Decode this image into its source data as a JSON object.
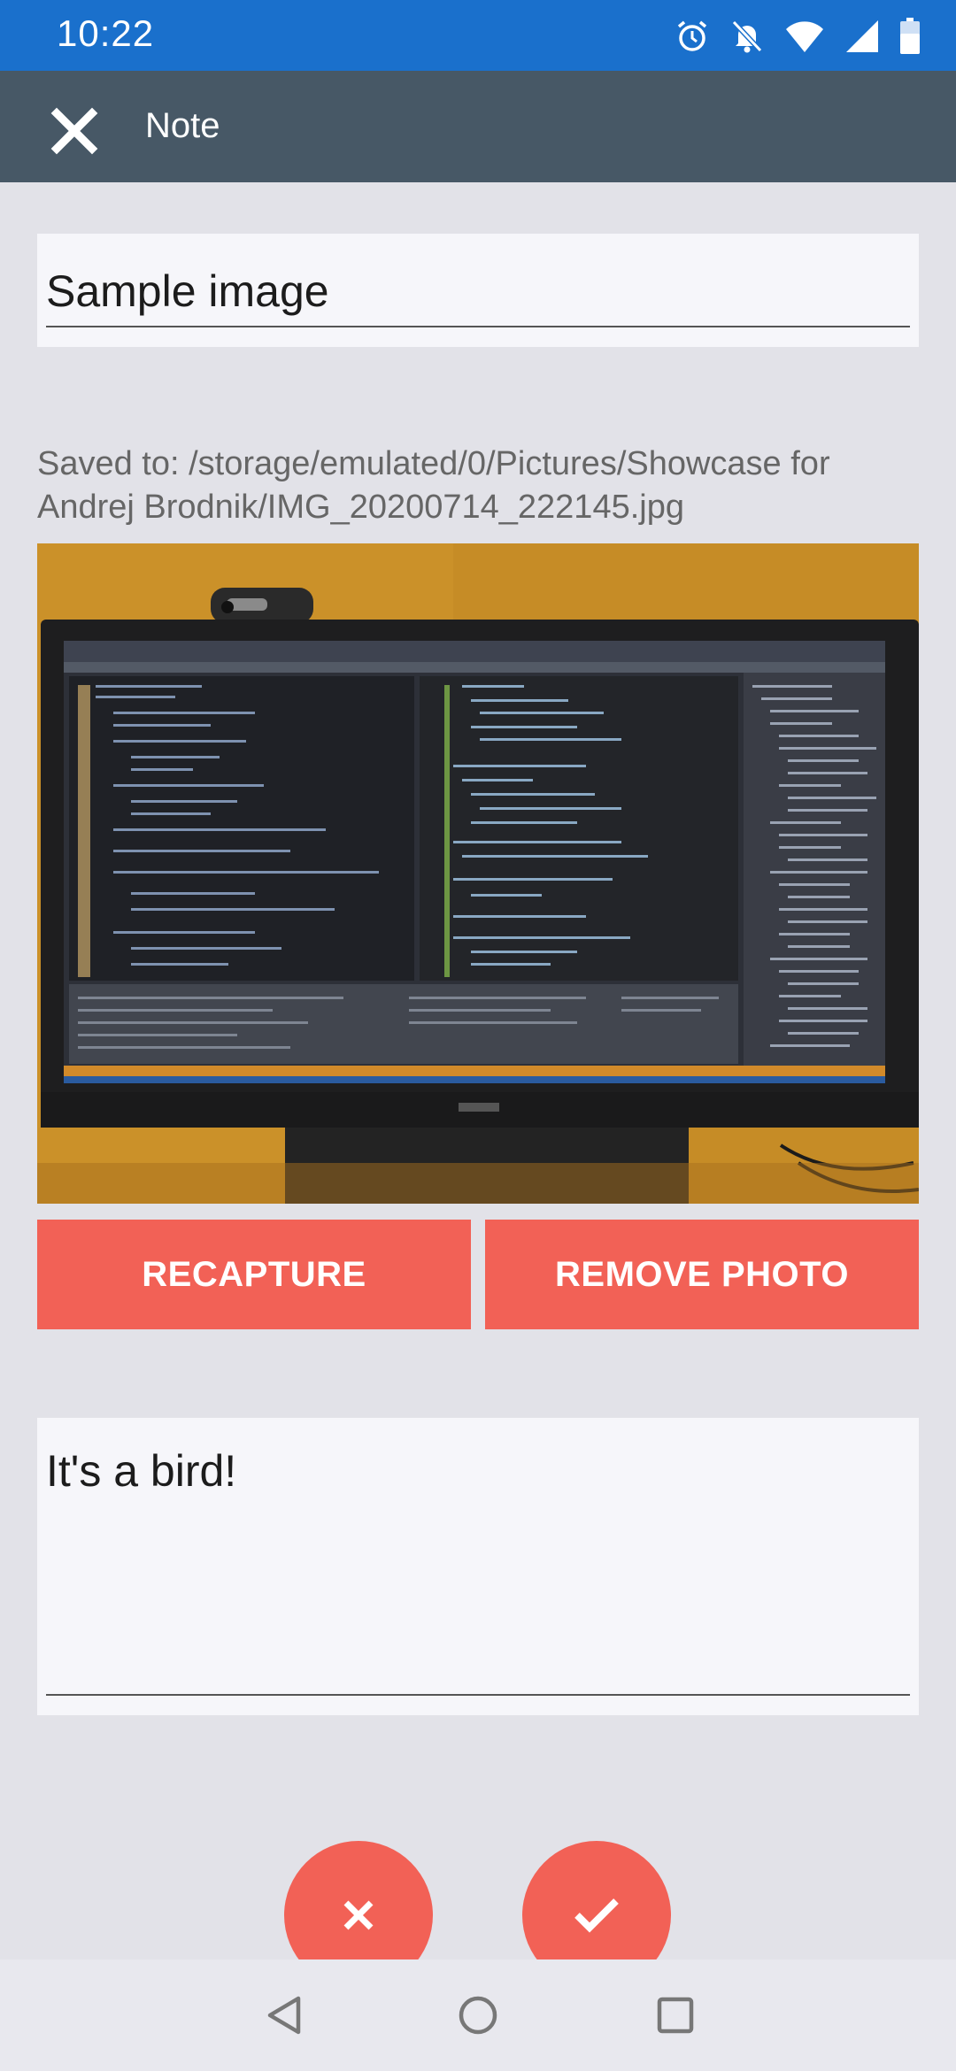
{
  "status_bar": {
    "time": "10:22",
    "icons": [
      "alarm-icon",
      "notifications-off-icon",
      "wifi-icon",
      "signal-icon",
      "battery-icon"
    ]
  },
  "app_bar": {
    "title": "Note",
    "close_icon": "close-icon"
  },
  "note": {
    "title_value": "Sample image",
    "saved_path": "Saved to: /storage/emulated/0/Pictures/Showcase for Andrej Brodnik/IMG_20200714_222145.jpg",
    "body_value": "It's a bird!"
  },
  "photo_actions": {
    "recapture_label": "RECAPTURE",
    "remove_label": "REMOVE PHOTO"
  },
  "fabs": {
    "cancel_icon": "close-icon",
    "confirm_icon": "check-icon"
  },
  "nav_bar": {
    "icons": [
      "back-icon",
      "home-icon",
      "recents-icon"
    ]
  },
  "colors": {
    "status_bar": "#1a70cc",
    "app_bar": "#475866",
    "accent": "#f26156",
    "background": "#e2e2e8",
    "card": "#f6f6fa"
  }
}
